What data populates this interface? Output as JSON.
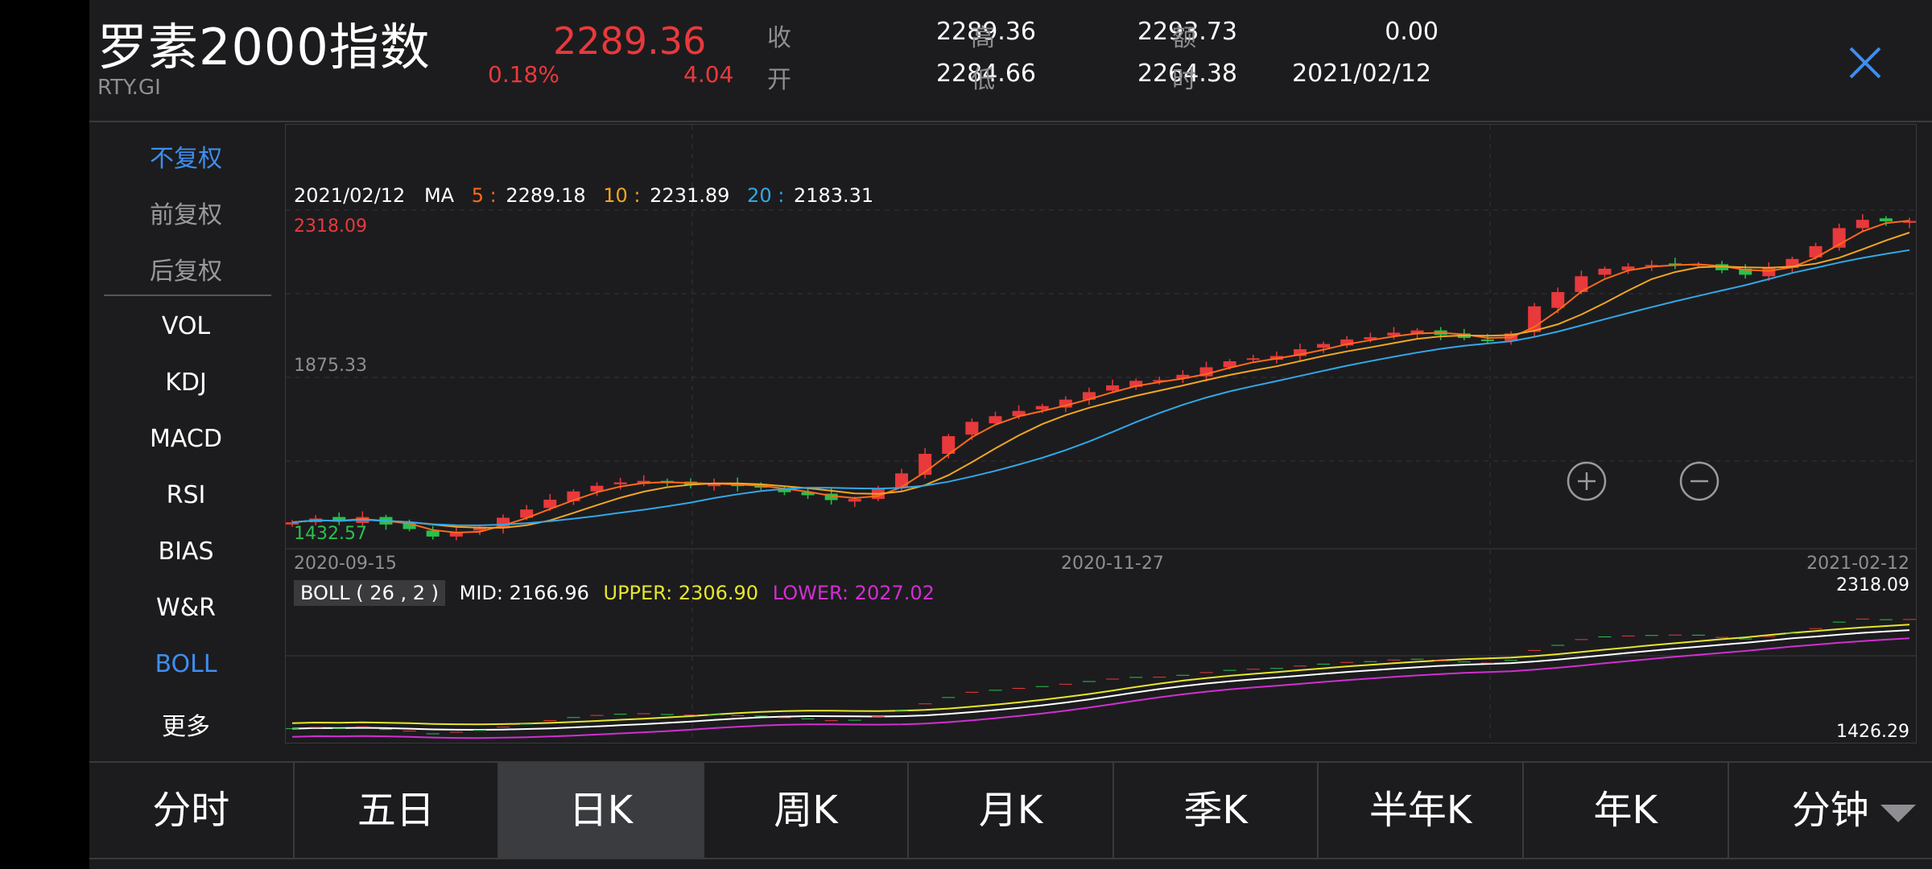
{
  "header": {
    "title": "罗素2000指数",
    "code": "RTY.GI",
    "price": "2289.36",
    "change_pct": "0.18%",
    "change": "4.04",
    "close_label": "收",
    "close_value": "2289.36",
    "open_label": "开",
    "open_value": "2284.66",
    "high_label": "高",
    "high_value": "2293.73",
    "low_label": "低",
    "low_value": "2264.38",
    "amount_label": "额",
    "amount_value": "0.00",
    "time_label": "时",
    "time_value": "2021/02/12"
  },
  "sidebar": {
    "items": [
      {
        "label": "不复权",
        "state": "active"
      },
      {
        "label": "前复权",
        "state": "muted"
      },
      {
        "label": "后复权",
        "state": "muted"
      },
      {
        "label": "VOL",
        "state": "normal"
      },
      {
        "label": "KDJ",
        "state": "normal"
      },
      {
        "label": "MACD",
        "state": "normal"
      },
      {
        "label": "RSI",
        "state": "normal"
      },
      {
        "label": "BIAS",
        "state": "normal"
      },
      {
        "label": "W&R",
        "state": "normal"
      },
      {
        "label": "BOLL",
        "state": "active"
      },
      {
        "label": "更多",
        "state": "normal"
      }
    ]
  },
  "chart": {
    "legend_date": "2021/02/12",
    "ma_label": "MA",
    "ma5_key": "5 :",
    "ma5_value": "2289.18",
    "ma10_key": "10 :",
    "ma10_value": "2231.89",
    "ma20_key": "20 :",
    "ma20_value": "2183.31",
    "y_max": "2318.09",
    "y_mid": "1875.33",
    "y_min": "1432.57",
    "x_start": "2020-09-15",
    "x_mid": "2020-11-27",
    "x_end": "2021-02-12",
    "boll_badge": "BOLL ( 26 , 2 )",
    "boll_mid": "MID: 2166.96",
    "boll_upper": "UPPER: 2306.90",
    "boll_lower": "LOWER: 2027.02",
    "boll_max": "2318.09",
    "boll_min": "1426.29"
  },
  "colors": {
    "up": "#e8393c",
    "down": "#27c24c",
    "ma5": "#ff6a1a",
    "ma10": "#f2a623",
    "ma20": "#33a7e8",
    "boll_mid": "#ffffff",
    "boll_upper": "#e6e62e",
    "boll_lower": "#d12fd1",
    "accent": "#3d8ef0"
  },
  "chart_data": {
    "type": "line",
    "series": [
      {
        "name": "MA",
        "y": [
          1488,
          1498,
          1490,
          1502,
          1482,
          1470,
          1450,
          1462,
          1476,
          1500,
          1522,
          1548,
          1570,
          1585,
          1594,
          1598,
          1592,
          1588,
          1592,
          1584,
          1580,
          1568,
          1560,
          1547,
          1550,
          1576,
          1618,
          1670,
          1717,
          1755,
          1770,
          1784,
          1797,
          1814,
          1834,
          1852,
          1864,
          1866,
          1880,
          1900,
          1916,
          1924,
          1930,
          1948,
          1962,
          1974,
          1980,
          1992,
          1998,
          1986,
          1978,
          1970,
          1990,
          2062,
          2100,
          2142,
          2162,
          2168,
          2172,
          2175,
          2174,
          2158,
          2146,
          2164,
          2188,
          2222,
          2270,
          2292,
          2288,
          2289
        ]
      }
    ],
    "ylim": [
      1432.57,
      2318.09
    ]
  },
  "tabs": [
    {
      "label": "分时",
      "active": false
    },
    {
      "label": "五日",
      "active": false
    },
    {
      "label": "日K",
      "active": true
    },
    {
      "label": "周K",
      "active": false
    },
    {
      "label": "月K",
      "active": false
    },
    {
      "label": "季K",
      "active": false
    },
    {
      "label": "半年K",
      "active": false
    },
    {
      "label": "年K",
      "active": false
    },
    {
      "label": "分钟",
      "active": false
    }
  ]
}
